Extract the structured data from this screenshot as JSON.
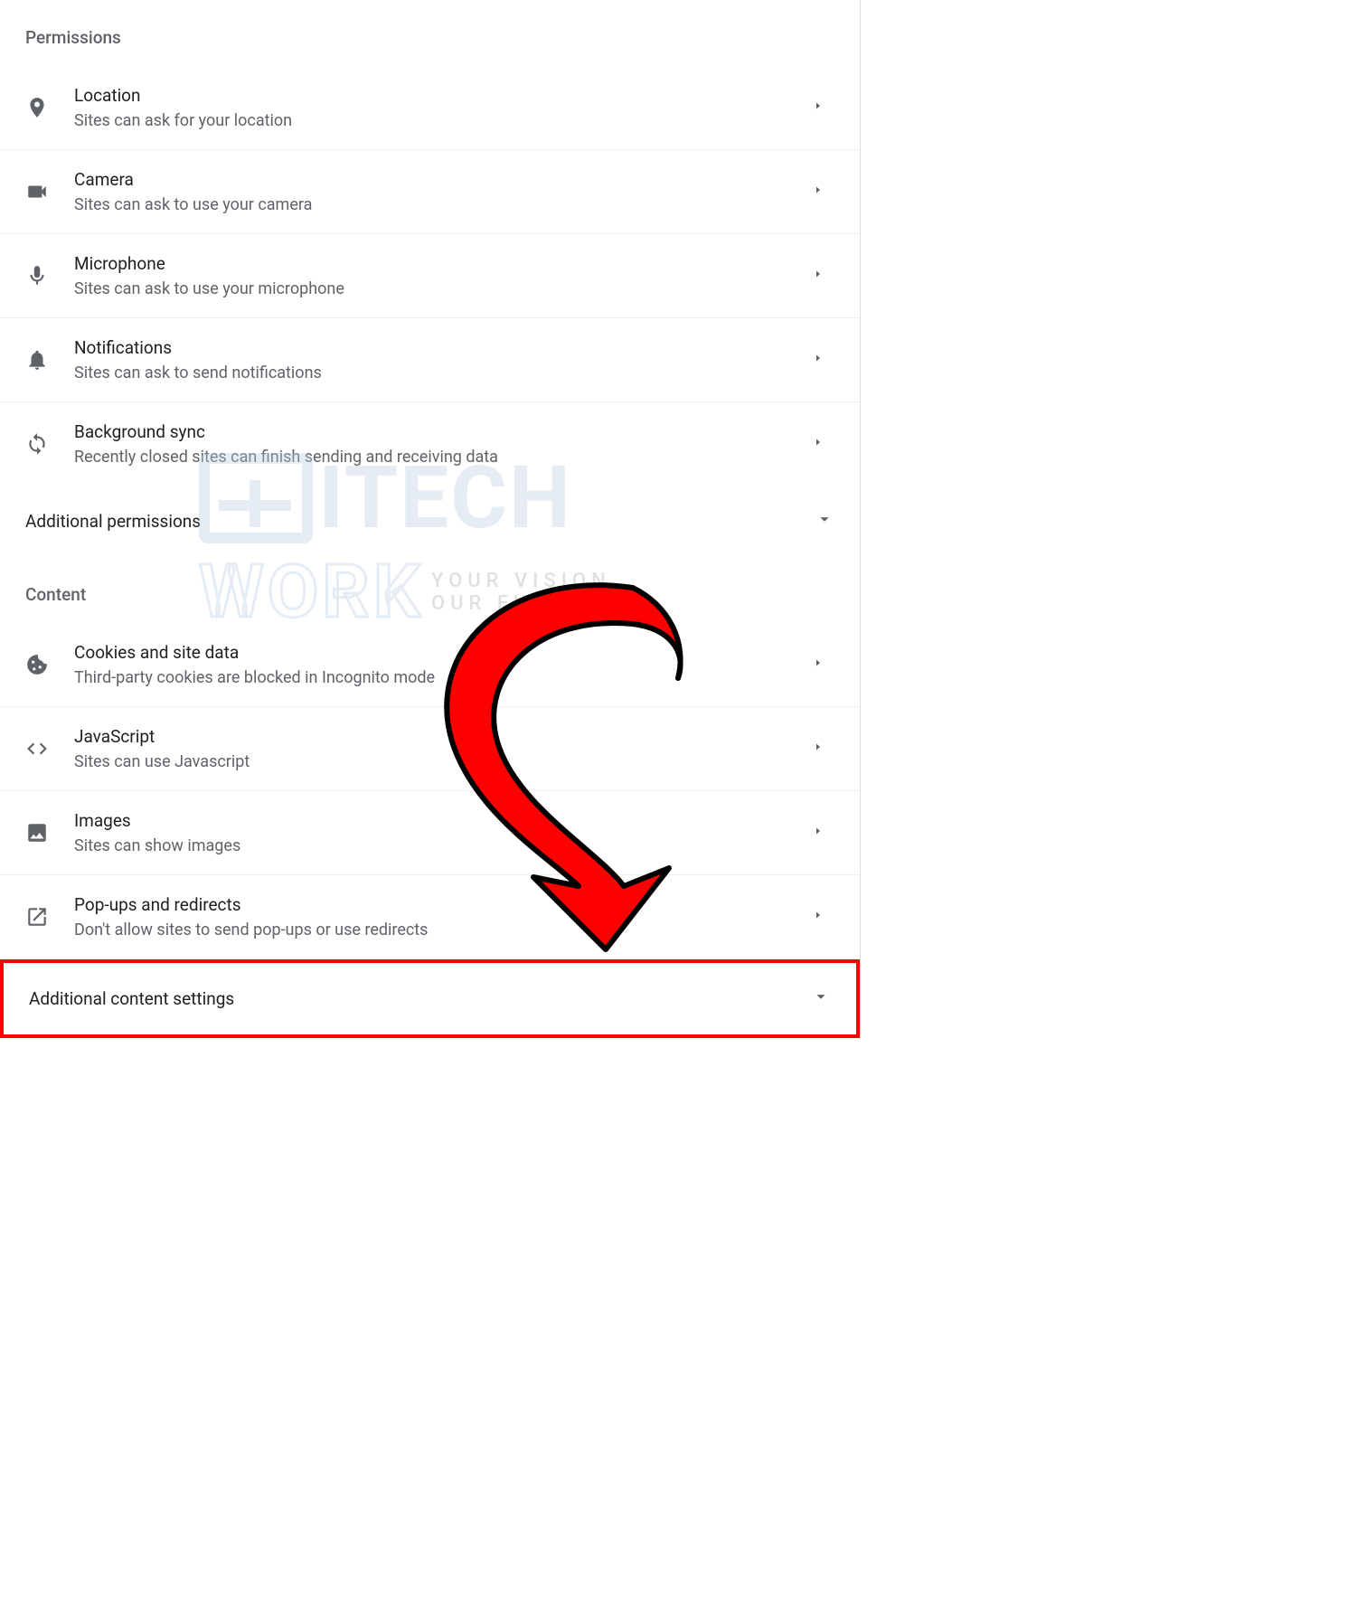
{
  "sections": {
    "permissions_header": "Permissions",
    "content_header": "Content"
  },
  "permissions": {
    "items": [
      {
        "title": "Location",
        "sub": "Sites can ask for your location"
      },
      {
        "title": "Camera",
        "sub": "Sites can ask to use your camera"
      },
      {
        "title": "Microphone",
        "sub": "Sites can ask to use your microphone"
      },
      {
        "title": "Notifications",
        "sub": "Sites can ask to send notifications"
      },
      {
        "title": "Background sync",
        "sub": "Recently closed sites can finish sending and receiving data"
      }
    ],
    "additional_label": "Additional permissions"
  },
  "content": {
    "items": [
      {
        "title": "Cookies and site data",
        "sub": "Third-party cookies are blocked in Incognito mode"
      },
      {
        "title": "JavaScript",
        "sub": "Sites can use Javascript"
      },
      {
        "title": "Images",
        "sub": "Sites can show images"
      },
      {
        "title": "Pop-ups and redirects",
        "sub": "Don't allow sites to send pop-ups or use redirects"
      }
    ],
    "additional_label": "Additional content settings"
  },
  "watermark": {
    "line1": "ITECH",
    "line2": "WORK",
    "tag1": "YOUR VISION",
    "tag2": "OUR FUTURE"
  }
}
